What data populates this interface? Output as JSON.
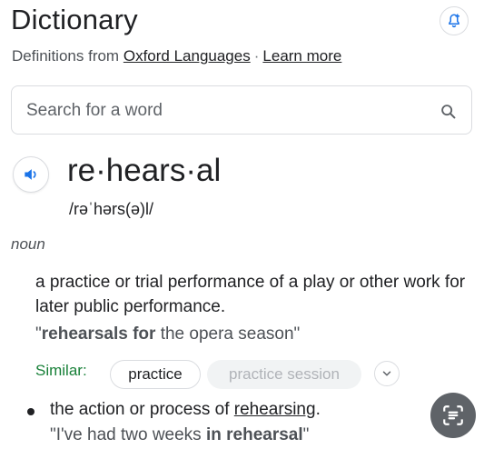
{
  "header": {
    "title": "Dictionary",
    "subtitle_prefix": "Definitions from",
    "source_link": "Oxford Languages",
    "separator": "·",
    "learn_more": "Learn more",
    "alert_icon": "bell-plus-icon"
  },
  "search": {
    "placeholder": "Search for a word",
    "value": "",
    "icon": "search-icon"
  },
  "entry": {
    "word": "re·hears·al",
    "phonetic": "/rəˈhərs(ə)l/",
    "part_of_speech": "noun",
    "speaker_icon": "speaker-icon",
    "accent_color": "#1a73e8",
    "definitions": [
      {
        "text": "a practice or trial performance of a play or other work for later public performance.",
        "example_open": "\"",
        "example_bold": "rehearsals for",
        "example_rest": " the opera season\"",
        "similar_label": "Similar:",
        "similar": [
          "practice",
          "practice session"
        ],
        "similar_color": "#188038"
      },
      {
        "text_prefix": "the action or process of ",
        "text_link": "rehearsing",
        "text_suffix": ".",
        "example_start": "\"I've had two weeks ",
        "example_bold": "in rehearsal",
        "example_end": "\""
      }
    ]
  },
  "fab": {
    "icon": "lens-icon"
  }
}
